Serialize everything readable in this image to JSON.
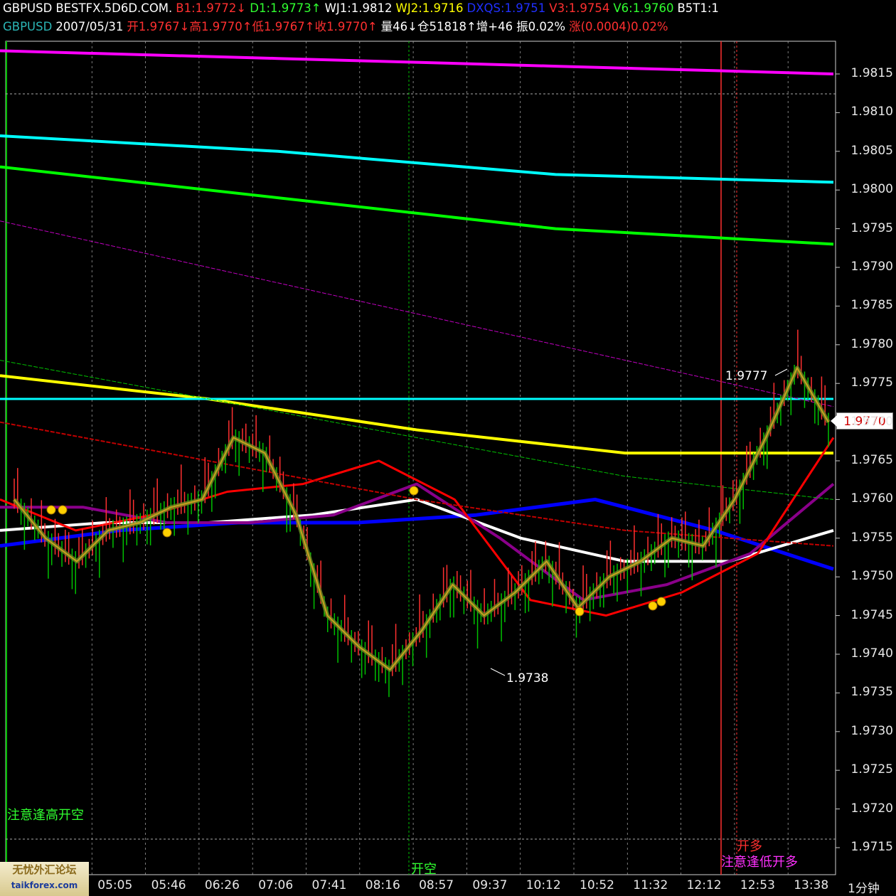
{
  "header_line1": [
    {
      "text": "GBPUSD",
      "color": "#ffffff"
    },
    {
      "text": "BESTFX.5D6D.COM.",
      "color": "#ffffff"
    },
    {
      "text": "B1:1.9772↓",
      "color": "#ff3030"
    },
    {
      "text": "D1:1.9773↑",
      "color": "#30ff30"
    },
    {
      "text": "WJ1:1.9812",
      "color": "#ffffff"
    },
    {
      "text": "WJ2:1.9716",
      "color": "#ffff00"
    },
    {
      "text": "DXQS:1.9751",
      "color": "#2030ff"
    },
    {
      "text": "V3:1.9754",
      "color": "#ff3030"
    },
    {
      "text": "V6:1.9760",
      "color": "#30ff30"
    },
    {
      "text": "B5T1:1",
      "color": "#ffffff"
    }
  ],
  "header_line2": [
    {
      "text": "GBPUSD",
      "color": "#2bb5b5"
    },
    {
      "text": "2007/05/31",
      "color": "#ffffff"
    },
    {
      "text": "开1.9767↓高1.9770↑低1.9767↑收1.9770↑",
      "color": "#ff3030"
    },
    {
      "text": "量46↓仓51818↑增+46",
      "color": "#ffffff"
    },
    {
      "text": "振0.02%",
      "color": "#ffffff"
    },
    {
      "text": "涨(0.0004)0.02%",
      "color": "#ff3030"
    }
  ],
  "chart_data": {
    "type": "line",
    "symbol": "GBPUSD",
    "timeframe": "1分钟",
    "date": "2007/05/31",
    "y_ticks": [
      "1.9815",
      "1.9810",
      "1.9805",
      "1.9800",
      "1.9795",
      "1.9790",
      "1.9785",
      "1.9780",
      "1.9775",
      "1.9770",
      "1.9765",
      "1.9760",
      "1.9755",
      "1.9750",
      "1.9745",
      "1.9740",
      "1.9735",
      "1.9730",
      "1.9725",
      "1.9720",
      "1.9715"
    ],
    "ylim": [
      1.9712,
      1.982
    ],
    "x_ticks": [
      "05:05",
      "05:46",
      "06:26",
      "07:06",
      "07:41",
      "08:16",
      "08:57",
      "09:37",
      "10:12",
      "10:52",
      "11:32",
      "12:12",
      "12:53",
      "13:38"
    ],
    "current_price": "1.9770",
    "high_label": "1.9777",
    "low_label": "1.9738",
    "series": [
      {
        "color": "#ff00ff",
        "width": 4,
        "values": [
          1.9818,
          1.9817,
          1.9816,
          1.9815
        ]
      },
      {
        "color": "#00ffff",
        "width": 4,
        "values": [
          1.9807,
          1.9805,
          1.9802,
          1.9801
        ]
      },
      {
        "color": "#00ff00",
        "width": 4,
        "values": [
          1.9803,
          1.9799,
          1.9795,
          1.9793
        ]
      },
      {
        "color": "#ffff00",
        "width": 4,
        "values": [
          1.9776,
          1.9773,
          1.9769,
          1.9766,
          1.9766
        ]
      },
      {
        "color": "#00ffff",
        "width": 3,
        "values": [
          1.9773,
          1.9773
        ]
      },
      {
        "color": "#0000ff",
        "width": 5,
        "values": [
          1.9754,
          1.9756,
          1.9757,
          1.9757,
          1.9758,
          1.976,
          1.9756,
          1.9751
        ]
      },
      {
        "color": "#ffffff",
        "width": 4,
        "values": [
          1.9756,
          1.9757,
          1.9757,
          1.9758,
          1.976,
          1.9755,
          1.9752,
          1.9752,
          1.9756
        ]
      },
      {
        "color": "#8a008a",
        "width": 4,
        "values": [
          1.9759,
          1.9759,
          1.9757,
          1.9757,
          1.9758,
          1.9762,
          1.9755,
          1.9747,
          1.9749,
          1.9753,
          1.9762
        ]
      },
      {
        "color": "#ff0000",
        "width": 3,
        "values": [
          1.976,
          1.9756,
          1.9758,
          1.9761,
          1.9762,
          1.9765,
          1.976,
          1.9747,
          1.9745,
          1.9748,
          1.9753,
          1.9768
        ]
      },
      {
        "color": "#c00000",
        "width": 2,
        "values": [
          1.977,
          1.9765,
          1.976,
          1.9756,
          1.9754
        ]
      },
      {
        "color": "#00c000",
        "width": 1,
        "values": [
          1.9778,
          1.9773,
          1.9768,
          1.9763,
          1.976
        ]
      },
      {
        "color": "#c000c0",
        "width": 1,
        "values": [
          1.9796,
          1.9788,
          1.978,
          1.9772
        ]
      }
    ],
    "price_path": [
      1.976,
      1.9755,
      1.9752,
      1.9756,
      1.9757,
      1.9759,
      1.976,
      1.9768,
      1.9766,
      1.9758,
      1.9745,
      1.9741,
      1.9738,
      1.9743,
      1.9749,
      1.9745,
      1.9748,
      1.9752,
      1.9746,
      1.975,
      1.9752,
      1.9755,
      1.9754,
      1.976,
      1.9768,
      1.9777,
      1.977
    ]
  },
  "price_labels": {
    "high": "1.9777",
    "low": "1.9738"
  },
  "annotations": {
    "left_signal": "注意逢高开空",
    "short_signal": "开空",
    "long_signal": "开多",
    "right_signal": "注意逢低开多"
  },
  "bottom_right_label": "1分钟",
  "watermark": {
    "title": "无忧外汇论坛",
    "url": "taikforex.com"
  },
  "colors": {
    "background": "#000000",
    "grid": "#9a9a9a",
    "up_bar": "#ff3030",
    "down_bar": "#00c000"
  }
}
